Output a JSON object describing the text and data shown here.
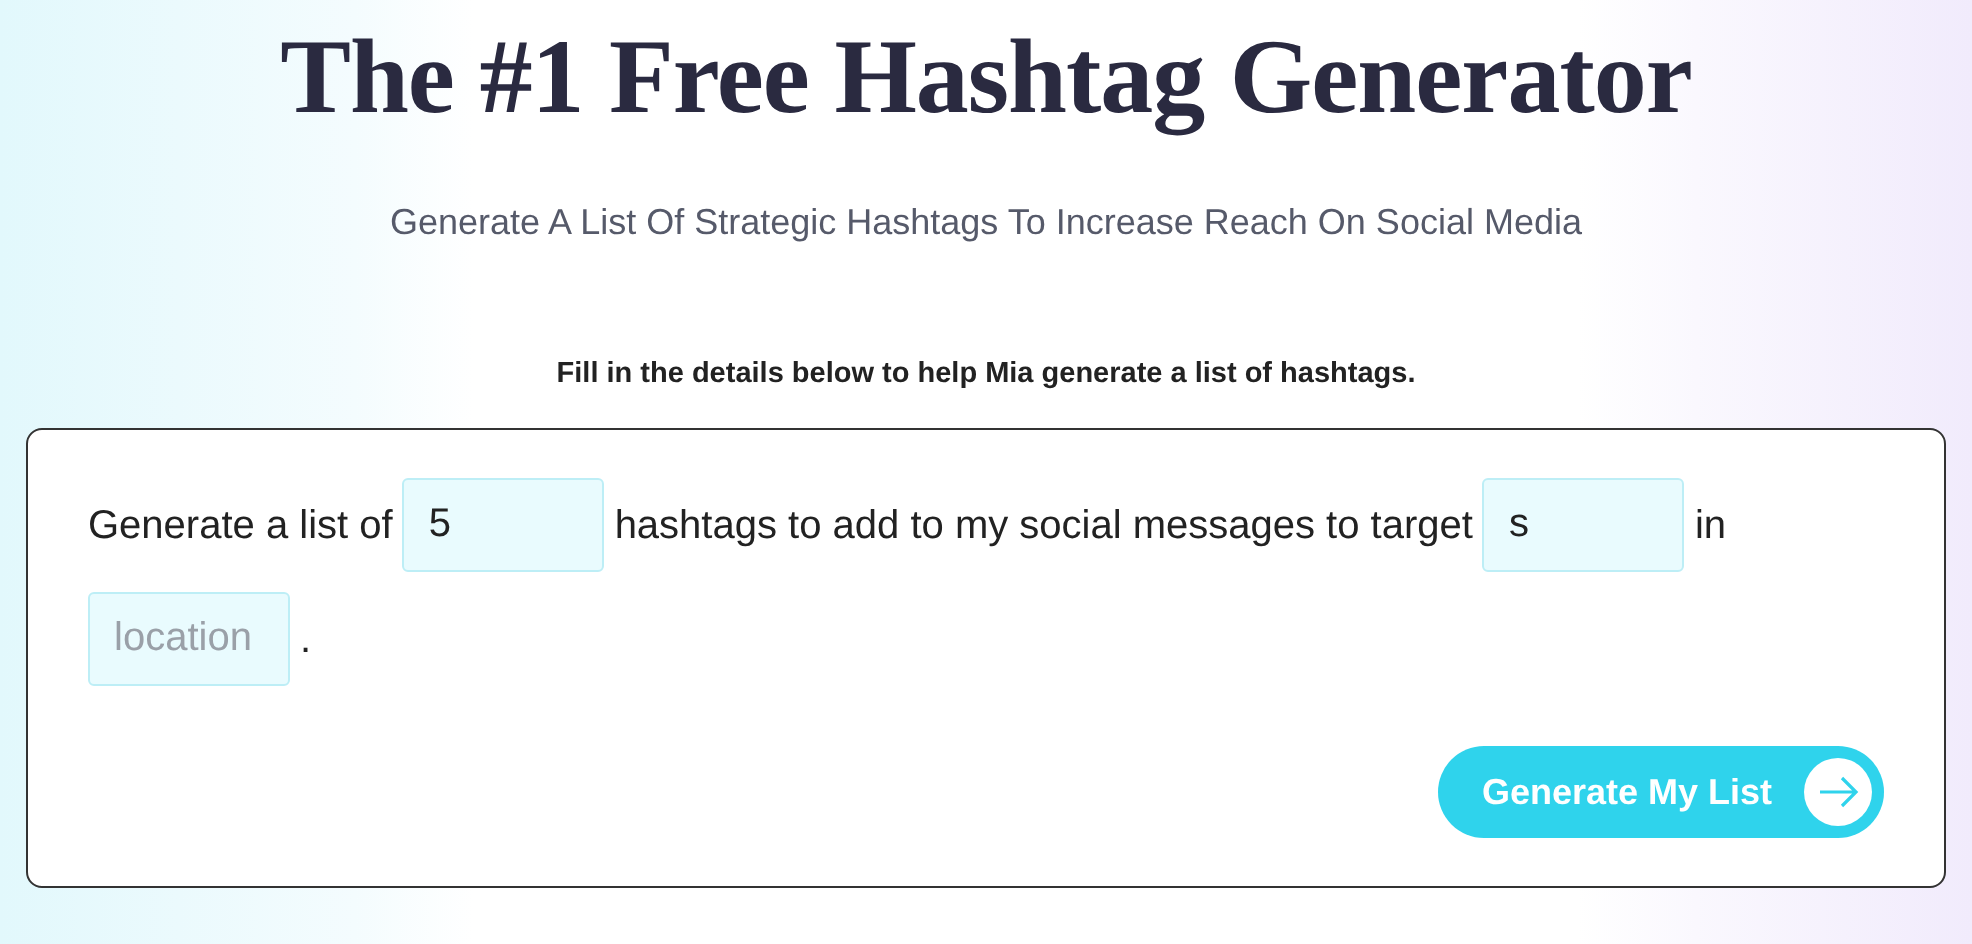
{
  "title": "The #1 Free Hashtag Generator",
  "subtitle": "Generate A List Of Strategic Hashtags To Increase Reach On Social Media",
  "instruction": "Fill in the details below to help Mia generate a list of hashtags.",
  "sentence": [
    {
      "kind": "text",
      "text": "Generate a list of"
    },
    {
      "kind": "field",
      "value": "5"
    },
    {
      "kind": "text",
      "text": "hashtags to add to my social messages to target"
    },
    {
      "kind": "field",
      "value": "s"
    },
    {
      "kind": "text",
      "text": "in"
    },
    {
      "kind": "field",
      "placeholder": "location"
    },
    {
      "kind": "text",
      "text": "."
    }
  ],
  "button": {
    "label": "Generate My List"
  }
}
